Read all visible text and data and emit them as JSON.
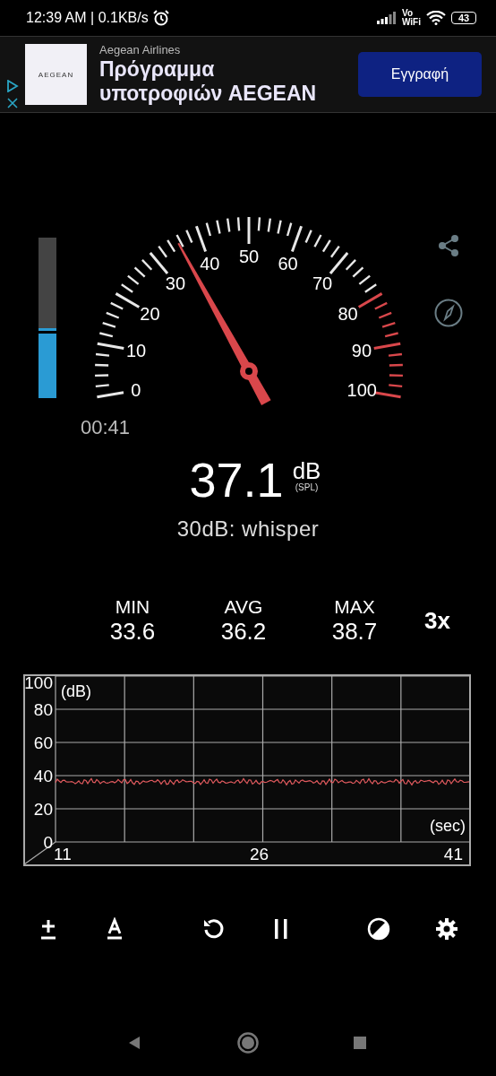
{
  "status_bar": {
    "time": "12:39 AM | 0.1KB/s",
    "network_top": "Vo",
    "network_bottom": "WiFi",
    "battery": "43"
  },
  "ad": {
    "advertiser": "Aegean Airlines",
    "logo": "AEGEAN",
    "headline": "Πρόγραμμα υποτροφιών AEGEAN",
    "button": "Εγγραφή"
  },
  "meter": {
    "level": 0.42
  },
  "gauge": {
    "labels": [
      {
        "text": "0",
        "kind": "normal"
      },
      {
        "text": "10",
        "kind": "normal"
      },
      {
        "text": "20",
        "kind": "normal"
      },
      {
        "text": "30",
        "kind": "normal"
      },
      {
        "text": "40",
        "kind": "normal"
      },
      {
        "text": "50",
        "kind": "normal"
      },
      {
        "text": "60",
        "kind": "normal"
      },
      {
        "text": "70",
        "kind": "normal"
      },
      {
        "text": "80",
        "kind": "loud"
      },
      {
        "text": "90",
        "kind": "loud"
      },
      {
        "text": "100",
        "kind": "loud"
      }
    ]
  },
  "timer": "00:41",
  "reading": {
    "value": "37.1",
    "unit": "dB",
    "weighting": "(SPL)",
    "description": "30dB: whisper"
  },
  "stats": [
    {
      "label": "MIN",
      "value": "33.6"
    },
    {
      "label": "AVG",
      "value": "36.2"
    },
    {
      "label": "MAX",
      "value": "38.7"
    }
  ],
  "speed": "3x",
  "graph": {
    "y_labels": [
      "100",
      "80",
      "60",
      "40",
      "20",
      "0"
    ],
    "ylabel": "(dB)",
    "xlabel": "(sec)",
    "x_labels": [
      "11",
      "26",
      "41"
    ]
  }
}
